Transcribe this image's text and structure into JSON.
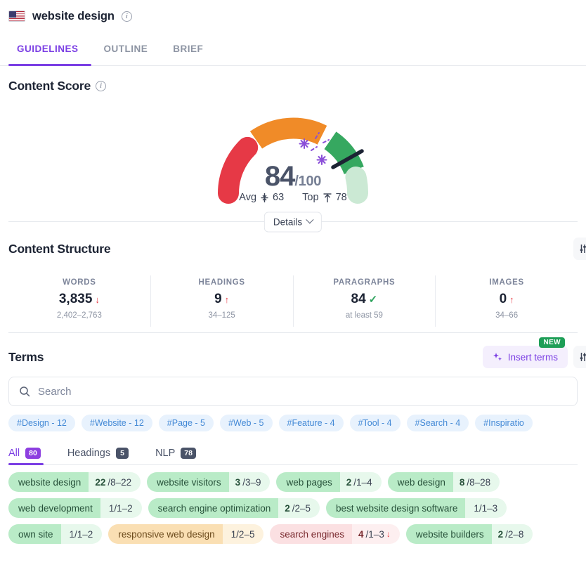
{
  "header": {
    "flag_icon": "us-flag-icon",
    "title": "website design",
    "info_icon": "info-icon"
  },
  "tabs": [
    {
      "label": "GUIDELINES",
      "active": true
    },
    {
      "label": "OUTLINE",
      "active": false
    },
    {
      "label": "BRIEF",
      "active": false
    }
  ],
  "content_score": {
    "title": "Content Score",
    "info_icon": "info-icon",
    "score": "84",
    "denominator": "/100",
    "avg_label": "Avg",
    "avg_value": "63",
    "avg_icon": "avg-arrow-icon",
    "top_label": "Top",
    "top_value": "78",
    "top_icon": "top-arrow-icon",
    "details_label": "Details",
    "chevron_icon": "chevron-down-icon",
    "gauge": {
      "needle_value": 84,
      "segments": [
        {
          "name": "low",
          "color": "#e63946",
          "from": 0,
          "to": 30
        },
        {
          "name": "mid",
          "color": "#f08b28",
          "from": 32,
          "to": 64
        },
        {
          "name": "good",
          "color": "#36a860",
          "from": 66,
          "to": 86
        },
        {
          "name": "rest",
          "color": "#cbe9d4",
          "from": 86,
          "to": 100
        }
      ],
      "sparkle_icon": "sparkle-decoration-icon"
    }
  },
  "content_structure": {
    "title": "Content Structure",
    "settings_icon": "sliders-icon",
    "metrics": [
      {
        "label": "WORDS",
        "value": "3,835",
        "status": "down",
        "range": "2,402–2,763"
      },
      {
        "label": "HEADINGS",
        "value": "9",
        "status": "up",
        "range": "34–125"
      },
      {
        "label": "PARAGRAPHS",
        "value": "84",
        "status": "ok",
        "range": "at least 59"
      },
      {
        "label": "IMAGES",
        "value": "0",
        "status": "up",
        "range": "34–66"
      }
    ]
  },
  "terms": {
    "title": "Terms",
    "insert_label": "Insert terms",
    "insert_icon": "sparkles-icon",
    "new_badge": "NEW",
    "settings_icon": "sliders-icon",
    "search": {
      "placeholder": "Search",
      "value": "",
      "icon": "search-icon"
    },
    "hashtags": [
      "#Design - 12",
      "#Website - 12",
      "#Page - 5",
      "#Web - 5",
      "#Feature - 4",
      "#Tool - 4",
      "#Search - 4",
      "#Inspiratio"
    ],
    "subtabs": [
      {
        "label": "All",
        "count": "80",
        "active": true
      },
      {
        "label": "Headings",
        "count": "5",
        "active": false
      },
      {
        "label": "NLP",
        "count": "78",
        "active": false
      }
    ],
    "rows": [
      [
        {
          "name": "website design",
          "current": "22",
          "range": "/8–22",
          "tone": "g",
          "arrow": ""
        },
        {
          "name": "website visitors",
          "current": "3",
          "range": "/3–9",
          "tone": "g",
          "arrow": ""
        },
        {
          "name": "web pages",
          "current": "2",
          "range": "/1–4",
          "tone": "g",
          "arrow": ""
        },
        {
          "name": "web design",
          "current": "8",
          "range": "/8–28",
          "tone": "g",
          "arrow": ""
        }
      ],
      [
        {
          "name": "web development",
          "current": "",
          "range": "1/1–2",
          "tone": "g",
          "arrow": ""
        },
        {
          "name": "search engine optimization",
          "current": "2",
          "range": "/2–5",
          "tone": "g",
          "arrow": ""
        },
        {
          "name": "best website design software",
          "current": "",
          "range": "1/1–3",
          "tone": "g",
          "arrow": ""
        }
      ],
      [
        {
          "name": "own site",
          "current": "",
          "range": "1/1–2",
          "tone": "g",
          "arrow": ""
        },
        {
          "name": "responsive web design",
          "current": "",
          "range": "1/2–5",
          "tone": "o",
          "arrow": ""
        },
        {
          "name": "search engines",
          "current": "4",
          "range": "/1–3",
          "tone": "r",
          "arrow": "↓"
        },
        {
          "name": "website builders",
          "current": "2",
          "range": "/2–8",
          "tone": "g",
          "arrow": ""
        }
      ]
    ]
  }
}
